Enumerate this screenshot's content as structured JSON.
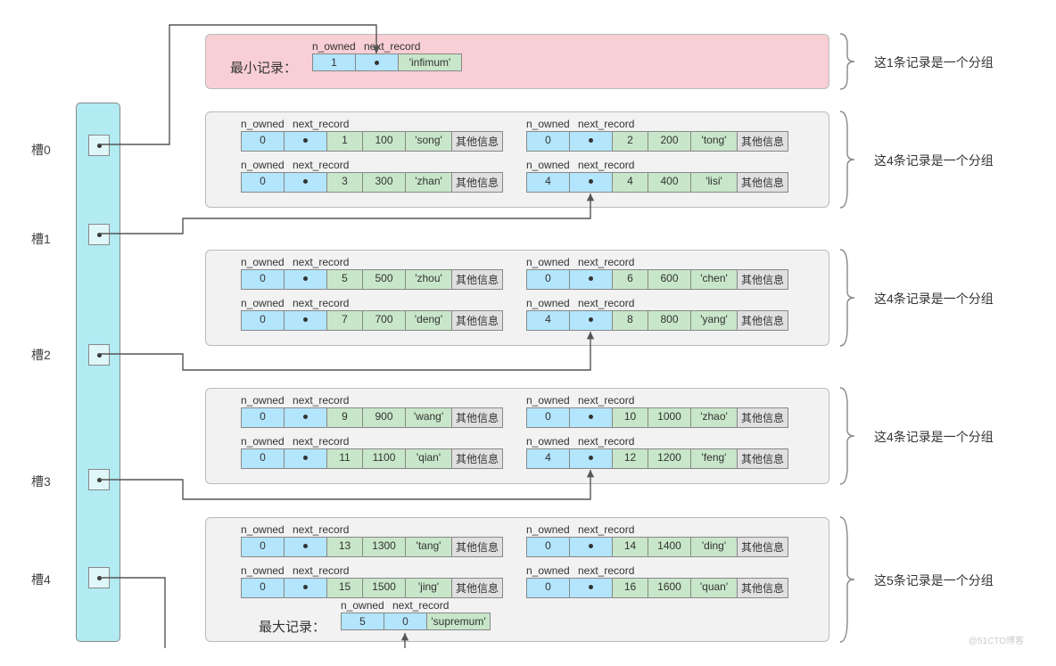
{
  "slots": [
    {
      "label": "槽0"
    },
    {
      "label": "槽1"
    },
    {
      "label": "槽2"
    },
    {
      "label": "槽3"
    },
    {
      "label": "槽4"
    }
  ],
  "header_labels": {
    "n_owned": "n_owned",
    "next_record": "next_record"
  },
  "infimum": {
    "prefix": "最小记录：",
    "n_owned": "1",
    "pointer": "·",
    "payload": "'infimum'"
  },
  "supremum": {
    "prefix": "最大记录：",
    "n_owned": "5",
    "next": "0",
    "payload": "'supremum'"
  },
  "records": [
    {
      "n_owned": "0",
      "id": "1",
      "val": "100",
      "name": "'song'",
      "extra": "其他信息"
    },
    {
      "n_owned": "0",
      "id": "2",
      "val": "200",
      "name": "'tong'",
      "extra": "其他信息"
    },
    {
      "n_owned": "0",
      "id": "3",
      "val": "300",
      "name": "'zhan'",
      "extra": "其他信息"
    },
    {
      "n_owned": "4",
      "id": "4",
      "val": "400",
      "name": "'lisi'",
      "extra": "其他信息"
    },
    {
      "n_owned": "0",
      "id": "5",
      "val": "500",
      "name": "'zhou'",
      "extra": "其他信息"
    },
    {
      "n_owned": "0",
      "id": "6",
      "val": "600",
      "name": "'chen'",
      "extra": "其他信息"
    },
    {
      "n_owned": "0",
      "id": "7",
      "val": "700",
      "name": "'deng'",
      "extra": "其他信息"
    },
    {
      "n_owned": "4",
      "id": "8",
      "val": "800",
      "name": "'yang'",
      "extra": "其他信息"
    },
    {
      "n_owned": "0",
      "id": "9",
      "val": "900",
      "name": "'wang'",
      "extra": "其他信息"
    },
    {
      "n_owned": "0",
      "id": "10",
      "val": "1000",
      "name": "'zhao'",
      "extra": "其他信息"
    },
    {
      "n_owned": "0",
      "id": "11",
      "val": "1100",
      "name": "'qian'",
      "extra": "其他信息"
    },
    {
      "n_owned": "4",
      "id": "12",
      "val": "1200",
      "name": "'feng'",
      "extra": "其他信息"
    },
    {
      "n_owned": "0",
      "id": "13",
      "val": "1300",
      "name": "'tang'",
      "extra": "其他信息"
    },
    {
      "n_owned": "0",
      "id": "14",
      "val": "1400",
      "name": "'ding'",
      "extra": "其他信息"
    },
    {
      "n_owned": "0",
      "id": "15",
      "val": "1500",
      "name": "'jing'",
      "extra": "其他信息"
    },
    {
      "n_owned": "0",
      "id": "16",
      "val": "1600",
      "name": "'quan'",
      "extra": "其他信息"
    }
  ],
  "group_labels": [
    "这1条记录是一个分组",
    "这4条记录是一个分组",
    "这4条记录是一个分组",
    "这4条记录是一个分组",
    "这5条记录是一个分组"
  ],
  "watermark": "@51CTO博客"
}
